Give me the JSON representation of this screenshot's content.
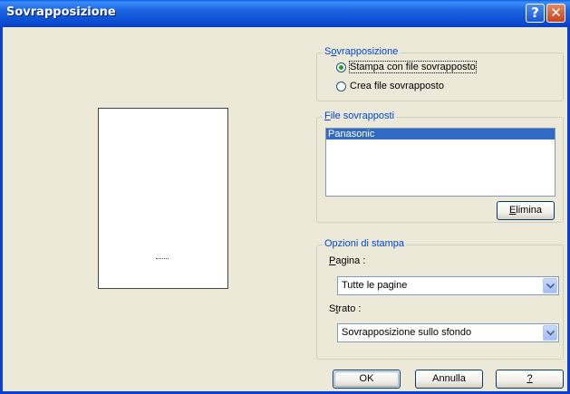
{
  "window": {
    "title": "Sovrapposizione",
    "help_label": "?",
    "close_label": "✕"
  },
  "overlay_group": {
    "legend_pre": "S",
    "legend_key": "o",
    "legend_post": "vrapposizione",
    "options": [
      {
        "label": "Stampa con file sovrapposto",
        "checked": true
      },
      {
        "label": "Crea file sovrapposto",
        "checked": false
      }
    ]
  },
  "files_group": {
    "legend_key": "F",
    "legend_post": "ile sovrapposti",
    "items": [
      "Panasonic"
    ],
    "delete_key": "E",
    "delete_post": "limina"
  },
  "print_group": {
    "legend": "Opzioni di stampa",
    "page_label_key": "P",
    "page_label_post": "agina :",
    "page_value": "Tutte le pagine",
    "layer_label_pre": "S",
    "layer_label_key": "t",
    "layer_label_post": "rato :",
    "layer_value": "Sovrapposizione sullo sfondo"
  },
  "buttons": {
    "ok": "OK",
    "cancel": "Annulla",
    "help": "?"
  },
  "preview": {
    "dots": "....."
  }
}
